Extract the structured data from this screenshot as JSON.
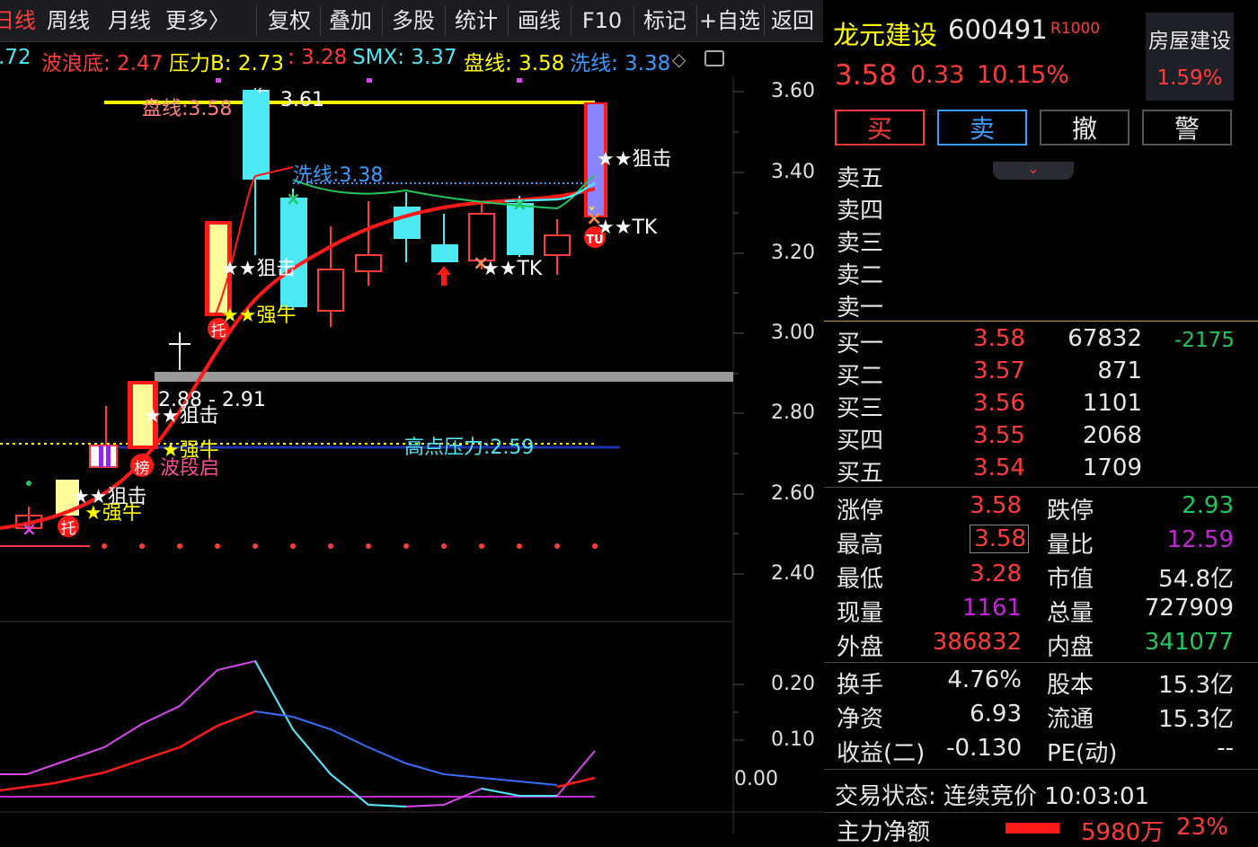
{
  "toolbar": {
    "items": [
      "日线",
      "周线",
      "月线",
      "更多〉",
      "复权",
      "叠加",
      "多股",
      "统计",
      "画线",
      "F10",
      "标记",
      "+自选",
      "返回"
    ]
  },
  "indicators": {
    "first": ".72",
    "wave_bottom": "波浪底: 2.47",
    "pressure_b": "压力B: 2.73",
    "colon_val": ": 3.28",
    "smx": "SMX: 3.37",
    "pan_line": "盘线: 3.58",
    "wash_line": "洗线: 3.38"
  },
  "chart_labels": {
    "pan": "盘线:3.58",
    "high": "3.61",
    "wash": "洗线:3.38",
    "snipe1": "★★狙击",
    "snipe2": "★★狙击",
    "snipe3": "★★狙击",
    "snipe4": "★★狙击",
    "tk1": "★★TK",
    "tk2": "★★TK",
    "bull1": "★★强牛",
    "bull2": "★强牛",
    "bull3": "★强牛",
    "range": "2.88 - 2.91",
    "wave_start": "波段启",
    "high_pressure": "高点压力:2.59",
    "tuo1": "托",
    "tuo2": "托",
    "bang": "榜",
    "tu": "TU"
  },
  "price_axis": [
    "3.60",
    "3.40",
    "3.20",
    "3.00",
    "2.80",
    "2.60",
    "2.40"
  ],
  "osc_axis": [
    "0.20",
    "0.10",
    "0.00"
  ],
  "stock": {
    "name": "龙元建设",
    "code": "600491",
    "tag": "R1000",
    "price": "3.58",
    "change": "0.33",
    "pct": "10.15%",
    "sector": "房屋建设",
    "sector_pct": "1.59%"
  },
  "actions": [
    "买",
    "卖",
    "撤",
    "警"
  ],
  "asks": [
    "卖五",
    "卖四",
    "卖三",
    "卖二",
    "卖一"
  ],
  "bids": [
    {
      "label": "买一",
      "price": "3.58",
      "vol": "67832",
      "delta": "-2175"
    },
    {
      "label": "买二",
      "price": "3.57",
      "vol": "871",
      "delta": ""
    },
    {
      "label": "买三",
      "price": "3.56",
      "vol": "1101",
      "delta": ""
    },
    {
      "label": "买四",
      "price": "3.55",
      "vol": "2068",
      "delta": ""
    },
    {
      "label": "买五",
      "price": "3.54",
      "vol": "1709",
      "delta": ""
    }
  ],
  "stats": [
    {
      "l1": "涨停",
      "v1": "3.58",
      "l2": "跌停",
      "v2": "2.93"
    },
    {
      "l1": "最高",
      "v1": "3.58",
      "l2": "量比",
      "v2": "12.59"
    },
    {
      "l1": "最低",
      "v1": "3.28",
      "l2": "市值",
      "v2": "54.8亿"
    },
    {
      "l1": "现量",
      "v1": "1161",
      "l2": "总量",
      "v2": "727909"
    },
    {
      "l1": "外盘",
      "v1": "386832",
      "l2": "内盘",
      "v2": "341077"
    }
  ],
  "stats2": [
    {
      "l1": "换手",
      "v1": "4.76%",
      "l2": "股本",
      "v2": "15.3亿"
    },
    {
      "l1": "净资",
      "v1": "6.93",
      "l2": "流通",
      "v2": "15.3亿"
    },
    {
      "l1": "收益(二)",
      "v1": "-0.130",
      "l2": "PE(动)",
      "v2": "--"
    }
  ],
  "trade_status": "交易状态: 连续竞价 10:03:01",
  "main_flow": {
    "label": "主力净额",
    "value": "5980万",
    "pct": "23%"
  },
  "colors": {
    "up": "#ff3b3b",
    "down": "#22c55e",
    "cyan": "#4de9f2",
    "yellow": "#ffff00",
    "purple": "#c026d3"
  }
}
